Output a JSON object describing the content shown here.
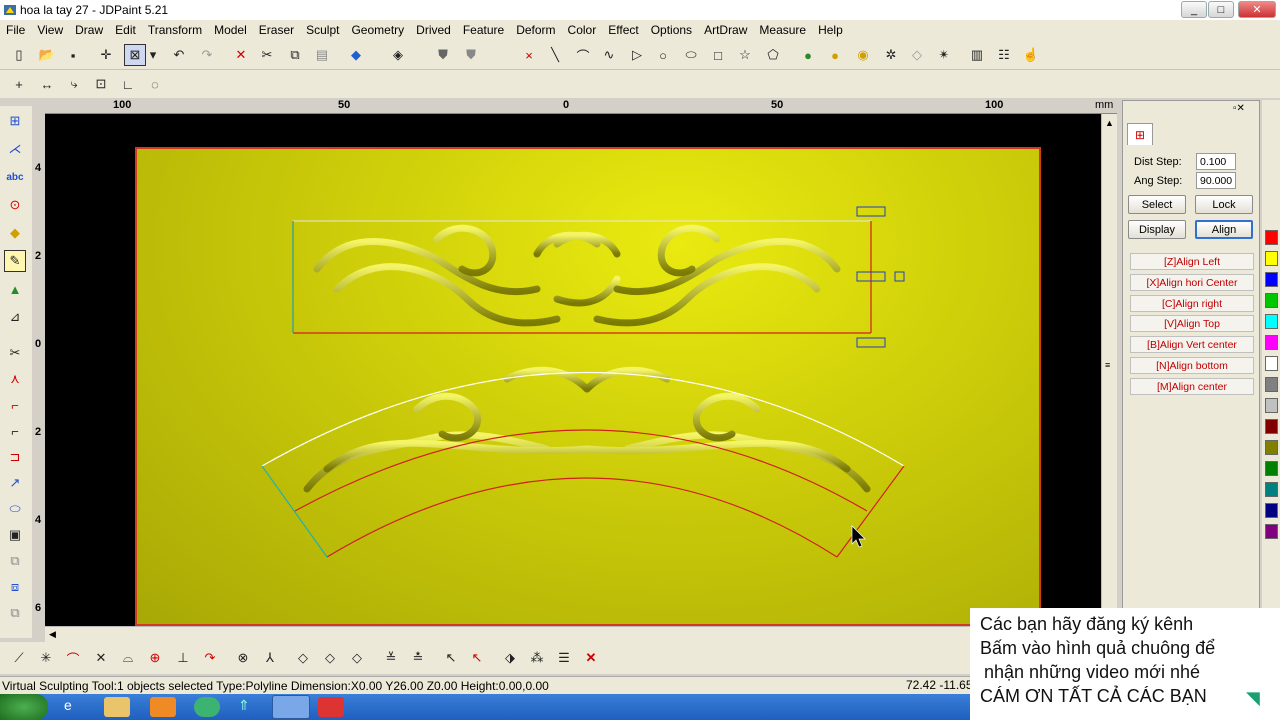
{
  "window": {
    "title": "hoa la tay 27 - JDPaint 5.21",
    "min_label": "_",
    "max_label": "□",
    "close_label": "✕"
  },
  "menu": [
    "File",
    "View",
    "Draw",
    "Edit",
    "Transform",
    "Model",
    "Eraser",
    "Sculpt",
    "Geometry",
    "Drived",
    "Feature",
    "Deform",
    "Color",
    "Effect",
    "Options",
    "ArtDraw",
    "Measure",
    "Help"
  ],
  "ruler": {
    "top_labels": [
      "100",
      "50",
      "0",
      "50",
      "100"
    ],
    "unit": "mm",
    "left_labels": [
      "4",
      "2",
      "0",
      "2",
      "4",
      "6"
    ]
  },
  "panel": {
    "dist_step_label": "Dist Step:",
    "dist_step_value": "0.100",
    "ang_step_label": "Ang Step:",
    "ang_step_value": "90.000",
    "select_label": "Select",
    "lock_label": "Lock",
    "display_label": "Display",
    "align_label": "Align",
    "align_items": [
      "[Z]Align Left",
      "[X]Align hori Center",
      "[C]Align right",
      "[V]Align Top",
      "[B]Align Vert center",
      "[N]Align bottom",
      "[M]Align center"
    ]
  },
  "palette": [
    "#ff0000",
    "#ffff00",
    "#0000ff",
    "#00c800",
    "#00ffff",
    "#ff00ff",
    "#ffffff",
    "#808080",
    "#c0c0c0",
    "#800000",
    "#808000",
    "#008000",
    "#008080",
    "#000080",
    "#800080"
  ],
  "status": {
    "text": "Virtual Sculpting Tool:1 objects selected Type:Polyline Dimension:X0.00 Y26.00 Z0.00 Height:0.00,0.00",
    "coords": "72.42 -11.65"
  },
  "overlay": {
    "line1": "Các bạn hãy đăng ký kênh",
    "line2": "Bấm vào hình quả chuông để",
    "line3": "nhận những video mới nhé",
    "line4": "CÁM ƠN TẤT CẢ CÁC BẠN"
  },
  "colors": {
    "plate": "#cfcf0a",
    "selection_outline": "#d02020",
    "accent_blue": "#2060d0"
  }
}
